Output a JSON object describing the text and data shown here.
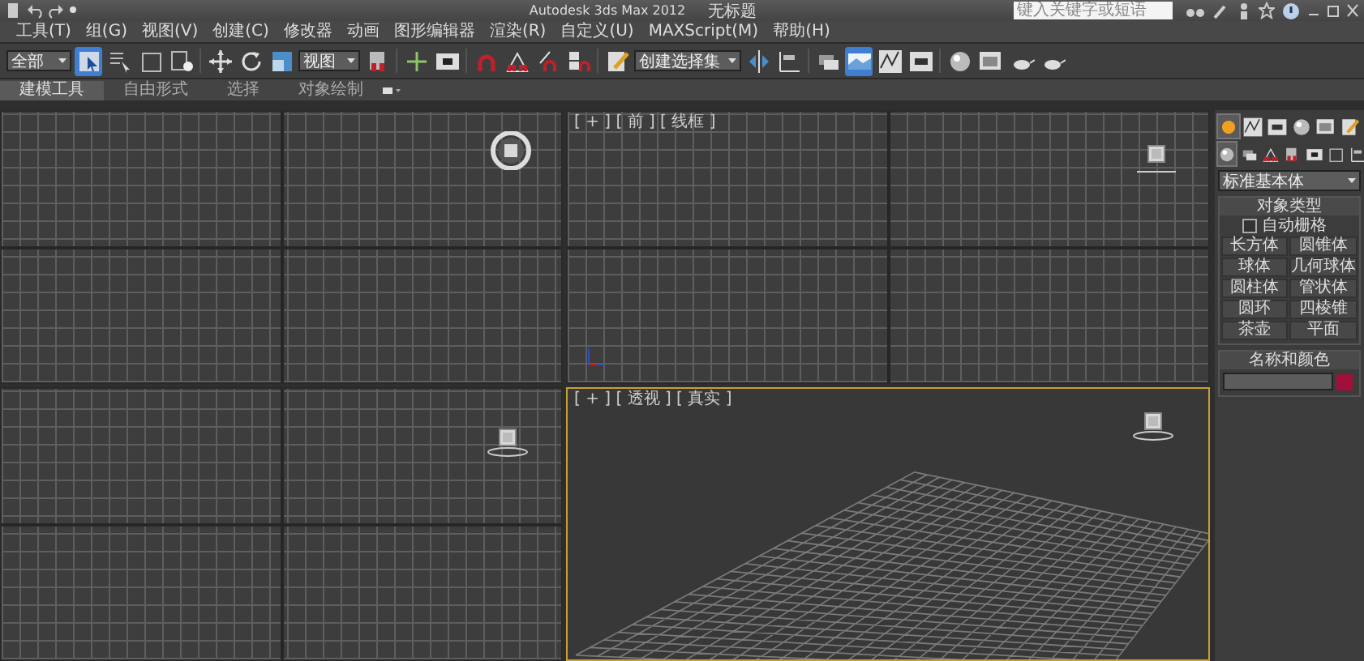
{
  "window": {
    "app_title": "Autodesk 3ds Max  2012",
    "document_title": "无标题"
  },
  "search": {
    "placeholder": "键入关键字或短语"
  },
  "menu": [
    "工具(T)",
    "组(G)",
    "视图(V)",
    "创建(C)",
    "修改器",
    "动画",
    "图形编辑器",
    "渲染(R)",
    "自定义(U)",
    "MAXScript(M)",
    "帮助(H)"
  ],
  "toolbar": {
    "selection_filter": "全部",
    "reference_coordinate": "视图",
    "named_selection_set": "创建选择集",
    "buttons": [
      {
        "selected": true
      },
      {
        "selected": false
      },
      {
        "selected": false
      },
      {
        "selected": false
      },
      {
        "selected": false
      },
      {
        "selected": false
      },
      {
        "selected": false
      },
      {
        "selected": false
      },
      {
        "selected": false
      },
      {
        "selected": false
      },
      {
        "selected": false
      },
      {
        "selected": false
      },
      {
        "selected": false
      },
      {
        "selected": false
      },
      {
        "selected": false
      },
      {
        "selected": false
      },
      {
        "selected": false
      },
      {
        "selected": false
      },
      {
        "selected": true
      },
      {
        "selected": false
      },
      {
        "selected": false
      },
      {
        "selected": false
      },
      {
        "selected": false
      },
      {
        "selected": false
      },
      {
        "selected": false
      }
    ]
  },
  "ribbon_tabs": [
    {
      "label": "建模工具",
      "selected": true
    },
    {
      "label": "自由形式",
      "selected": false
    },
    {
      "label": "选择",
      "selected": false
    },
    {
      "label": "对象绘制",
      "selected": false
    }
  ],
  "viewports": [
    {
      "kind": "grid",
      "active": false
    },
    {
      "kind": "grid",
      "active": false,
      "label": "[ + ] [ 前 ] [ 线框 ]",
      "axis": true
    },
    {
      "kind": "grid",
      "active": false
    },
    {
      "kind": "perspective",
      "active": true,
      "label": "[ + ] [ 透视 ] [ 真实 ]"
    }
  ],
  "command_panel": {
    "tabs": [
      {
        "selected": true
      },
      {
        "selected": false
      },
      {
        "selected": false
      },
      {
        "selected": false
      },
      {
        "selected": false
      },
      {
        "selected": false
      }
    ],
    "categories": [
      {
        "selected": true
      },
      {
        "selected": false
      },
      {
        "selected": false
      },
      {
        "selected": false
      },
      {
        "selected": false
      },
      {
        "selected": false
      },
      {
        "selected": false
      }
    ],
    "dropdown": "标准基本体",
    "object_type": {
      "title": "对象类型",
      "autogrid": {
        "label": "自动栅格",
        "checked": false
      },
      "buttons": [
        "长方体",
        "圆锥体",
        "球体",
        "几何球体",
        "圆柱体",
        "管状体",
        "圆环",
        "四棱锥",
        "茶壶",
        "平面"
      ]
    },
    "name_and_color": {
      "title": "名称和颜色",
      "color": "#a0103a"
    }
  }
}
